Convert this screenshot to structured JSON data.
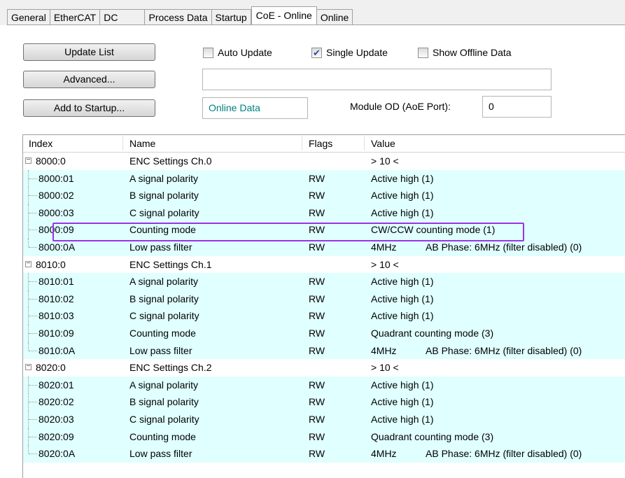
{
  "tabs": [
    "General",
    "EtherCAT",
    "DC",
    "Process Data",
    "Startup",
    "CoE - Online",
    "Online"
  ],
  "active_tab": "CoE - Online",
  "buttons": {
    "update_list": "Update List",
    "advanced": "Advanced...",
    "add_to_startup": "Add to Startup..."
  },
  "checkboxes": {
    "auto_update": {
      "label": "Auto Update",
      "checked": false
    },
    "single_update": {
      "label": "Single Update",
      "checked": true
    },
    "show_offline": {
      "label": "Show Offline Data",
      "checked": false
    }
  },
  "fields": {
    "empty_value": "",
    "data_source": "Online Data",
    "module_od_label": "Module OD (AoE Port):",
    "module_od_value": "0"
  },
  "columns": {
    "index": "Index",
    "name": "Name",
    "flags": "Flags",
    "value": "Value"
  },
  "rows": [
    {
      "index": "8000:0",
      "name": "ENC Settings Ch.0",
      "flags": "",
      "value": "> 10 <",
      "value2": "",
      "group": true
    },
    {
      "index": "8000:01",
      "name": "A signal polarity",
      "flags": "RW",
      "value": "Active high (1)",
      "value2": ""
    },
    {
      "index": "8000:02",
      "name": "B signal polarity",
      "flags": "RW",
      "value": "Active high (1)",
      "value2": ""
    },
    {
      "index": "8000:03",
      "name": "C signal polarity",
      "flags": "RW",
      "value": "Active high (1)",
      "value2": ""
    },
    {
      "index": "8000:09",
      "name": "Counting mode",
      "flags": "RW",
      "value": "CW/CCW counting mode (1)",
      "value2": "",
      "highlight": true
    },
    {
      "index": "8000:0A",
      "name": "Low pass filter",
      "flags": "RW",
      "value": "4MHz",
      "value2": "AB Phase: 6MHz (filter disabled) (0)"
    },
    {
      "index": "8010:0",
      "name": "ENC Settings Ch.1",
      "flags": "",
      "value": "> 10 <",
      "value2": "",
      "group": true
    },
    {
      "index": "8010:01",
      "name": "A signal polarity",
      "flags": "RW",
      "value": "Active high (1)",
      "value2": ""
    },
    {
      "index": "8010:02",
      "name": "B signal polarity",
      "flags": "RW",
      "value": "Active high (1)",
      "value2": ""
    },
    {
      "index": "8010:03",
      "name": "C signal polarity",
      "flags": "RW",
      "value": "Active high (1)",
      "value2": ""
    },
    {
      "index": "8010:09",
      "name": "Counting mode",
      "flags": "RW",
      "value": "Quadrant counting mode (3)",
      "value2": ""
    },
    {
      "index": "8010:0A",
      "name": "Low pass filter",
      "flags": "RW",
      "value": "4MHz",
      "value2": "AB Phase: 6MHz (filter disabled) (0)"
    },
    {
      "index": "8020:0",
      "name": "ENC Settings Ch.2",
      "flags": "",
      "value": "> 10 <",
      "value2": "",
      "group": true
    },
    {
      "index": "8020:01",
      "name": "A signal polarity",
      "flags": "RW",
      "value": "Active high (1)",
      "value2": ""
    },
    {
      "index": "8020:02",
      "name": "B signal polarity",
      "flags": "RW",
      "value": "Active high (1)",
      "value2": ""
    },
    {
      "index": "8020:03",
      "name": "C signal polarity",
      "flags": "RW",
      "value": "Active high (1)",
      "value2": ""
    },
    {
      "index": "8020:09",
      "name": "Counting mode",
      "flags": "RW",
      "value": "Quadrant counting mode (3)",
      "value2": ""
    },
    {
      "index": "8020:0A",
      "name": "Low pass filter",
      "flags": "RW",
      "value": "4MHz",
      "value2": "AB Phase: 6MHz (filter disabled) (0)"
    }
  ],
  "colors": {
    "subrow_bg": "#e0ffff",
    "highlight_border": "#9b32e6",
    "online_data_text": "#008080"
  }
}
